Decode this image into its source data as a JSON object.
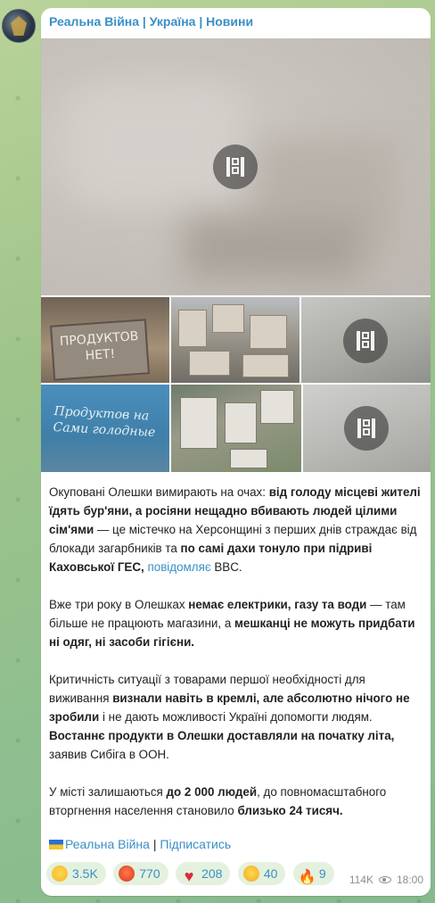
{
  "channel": {
    "title": "Реальна Війна | Україна | Новини"
  },
  "media": {
    "tiles": [
      {
        "kind": "video",
        "icon": "film-play-icon"
      },
      {
        "kind": "photo",
        "text": "ПРОДУКТОВ НЕТ!"
      },
      {
        "kind": "photo"
      },
      {
        "kind": "video",
        "icon": "film-play-icon"
      },
      {
        "kind": "photo",
        "text": "Продуктов на\nСами голодные"
      },
      {
        "kind": "photo"
      },
      {
        "kind": "video",
        "icon": "film-play-icon"
      }
    ]
  },
  "post": {
    "p1": {
      "a": "Окуповані Олешки вимирають на очах: ",
      "b": "від голоду місцеві жителі їдять бур'яни, а росіяни нещадно вбивають людей цілими сім'ями",
      "c": " — це містечко на Херсонщині з перших днів страждає від блокади загарбників та ",
      "d": "по самі дахи тонуло при підриві Каховської ГЕС,",
      "e": " ",
      "link": "повідомляє",
      "f": " BBC."
    },
    "p2": {
      "a": "Вже три року в Олешках ",
      "b": "немає електрики, газу та води",
      "c": " — там більше не працюють магазини, а ",
      "d": "мешканці не можуть придбати ні одяг, ні засоби гігієни."
    },
    "p3": {
      "a": "Критичність ситуації з товарами першої необхідності для виживання ",
      "b": "визнали навіть в кремлі, але абсолютно нічого не зробили",
      "c": " і не дають можливості Україні допомогти людям. ",
      "d": "Востаннє продукти в Олешки доставляли на початку літа,",
      "e": " заявив Сибіга в ООН."
    },
    "p4": {
      "a": "У місті залишаються ",
      "b": "до 2 000 людей",
      "c": ", до повномасштабного вторгнення населення становило ",
      "d": "близько 24 тисяч."
    }
  },
  "footer": {
    "channel_link": "Реальна Війна",
    "separator": " | ",
    "subscribe_link": "Підписатись"
  },
  "reactions": [
    {
      "emoji": "crying-face-icon",
      "count": "3.5K"
    },
    {
      "emoji": "angry-face-icon",
      "count": "770"
    },
    {
      "emoji": "heart-icon",
      "count": "208"
    },
    {
      "emoji": "grinning-face-icon",
      "count": "40"
    },
    {
      "emoji": "fire-icon",
      "count": "9"
    }
  ],
  "meta": {
    "views": "114K",
    "time": "18:00"
  },
  "colors": {
    "link": "#3a8fc7",
    "bubble": "#ffffff",
    "reaction_bg": "#e4f1de"
  }
}
